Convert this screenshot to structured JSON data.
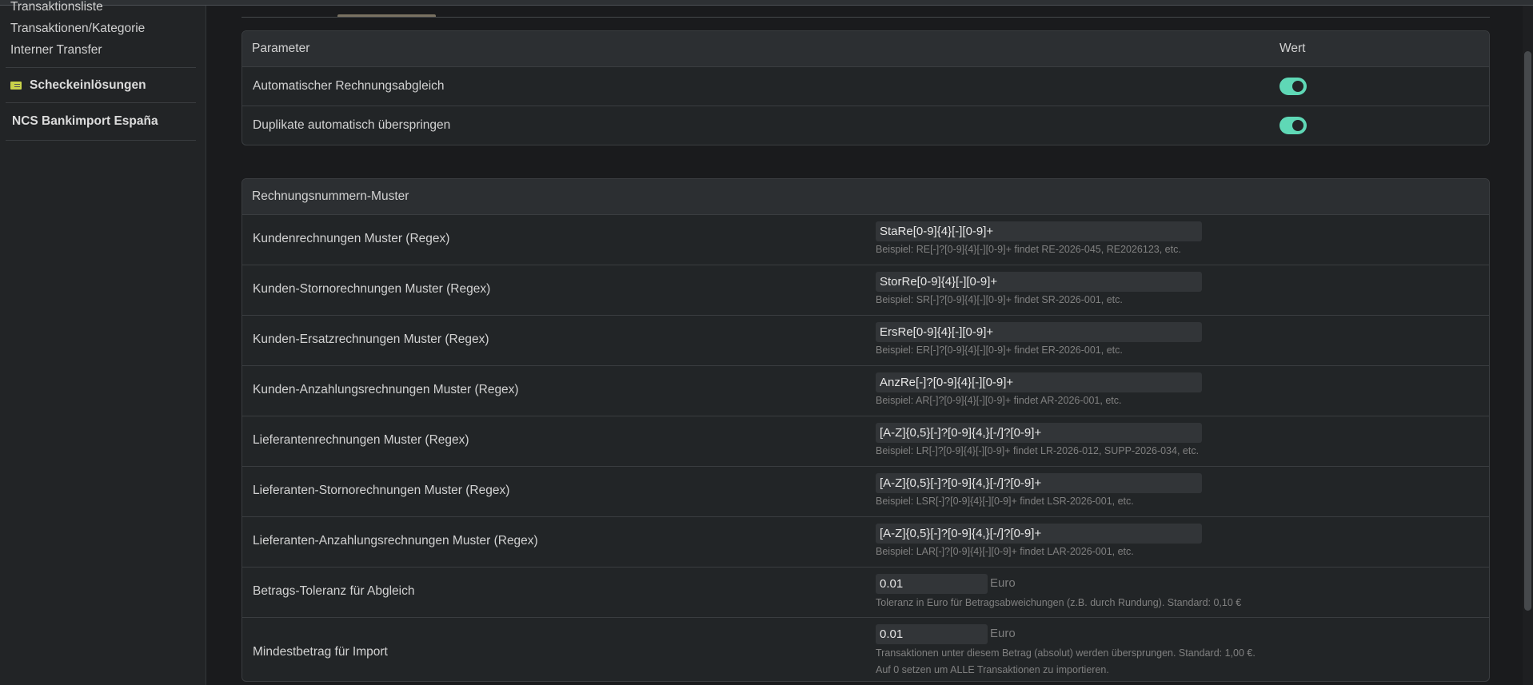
{
  "sidebar": {
    "items": [
      "Transaktionsliste",
      "Transaktionen/Kategorie",
      "Interner Transfer"
    ],
    "scheck": "Scheckeinlösungen",
    "ncs": "NCS Bankimport España"
  },
  "params": {
    "header_param": "Parameter",
    "header_value": "Wert",
    "rows": [
      {
        "label": "Automatischer Rechnungsabgleich",
        "enabled": true
      },
      {
        "label": "Duplikate automatisch überspringen",
        "enabled": true
      }
    ]
  },
  "patterns": {
    "title": "Rechnungsnummern-Muster",
    "rows": [
      {
        "label": "Kundenrechnungen Muster (Regex)",
        "value": "StaRe[0-9]{4}[-][0-9]+",
        "hint": "Beispiel: RE[-]?[0-9]{4}[-][0-9]+ findet RE-2026-045, RE2026123, etc."
      },
      {
        "label": "Kunden-Stornorechnungen Muster (Regex)",
        "value": "StorRe[0-9]{4}[-][0-9]+",
        "hint": "Beispiel: SR[-]?[0-9]{4}[-][0-9]+ findet SR-2026-001, etc."
      },
      {
        "label": "Kunden-Ersatzrechnungen Muster (Regex)",
        "value": "ErsRe[0-9]{4}[-][0-9]+",
        "hint": "Beispiel: ER[-]?[0-9]{4}[-][0-9]+ findet ER-2026-001, etc."
      },
      {
        "label": "Kunden-Anzahlungsrechnungen Muster (Regex)",
        "value": "AnzRe[-]?[0-9]{4}[-][0-9]+",
        "hint": "Beispiel: AR[-]?[0-9]{4}[-][0-9]+ findet AR-2026-001, etc."
      },
      {
        "label": "Lieferantenrechnungen Muster (Regex)",
        "value": "[A-Z]{0,5}[-]?[0-9]{4,}[-/]?[0-9]+",
        "hint": "Beispiel: LR[-]?[0-9]{4}[-][0-9]+ findet LR-2026-012, SUPP-2026-034, etc."
      },
      {
        "label": "Lieferanten-Stornorechnungen Muster (Regex)",
        "value": "[A-Z]{0,5}[-]?[0-9]{4,}[-/]?[0-9]+",
        "hint": "Beispiel: LSR[-]?[0-9]{4}[-][0-9]+ findet LSR-2026-001, etc."
      },
      {
        "label": "Lieferanten-Anzahlungsrechnungen Muster (Regex)",
        "value": "[A-Z]{0,5}[-]?[0-9]{4,}[-/]?[0-9]+",
        "hint": "Beispiel: LAR[-]?[0-9]{4}[-][0-9]+ findet LAR-2026-001, etc."
      },
      {
        "label": "Betrags-Toleranz für Abgleich",
        "value": "0.01",
        "unit": "Euro",
        "hint": "Toleranz in Euro für Betragsabweichungen (z.B. durch Rundung). Standard: 0,10 €"
      },
      {
        "label": "Mindestbetrag für Import",
        "value": "0.01",
        "unit": "Euro",
        "hint": "Transaktionen unter diesem Betrag (absolut) werden übersprungen. Standard: 1,00 €. Auf 0 setzen um ALLE Transaktionen zu importieren."
      }
    ]
  },
  "colors": {
    "accent": "#5fd8b6",
    "tab_active": "#7a7262"
  }
}
